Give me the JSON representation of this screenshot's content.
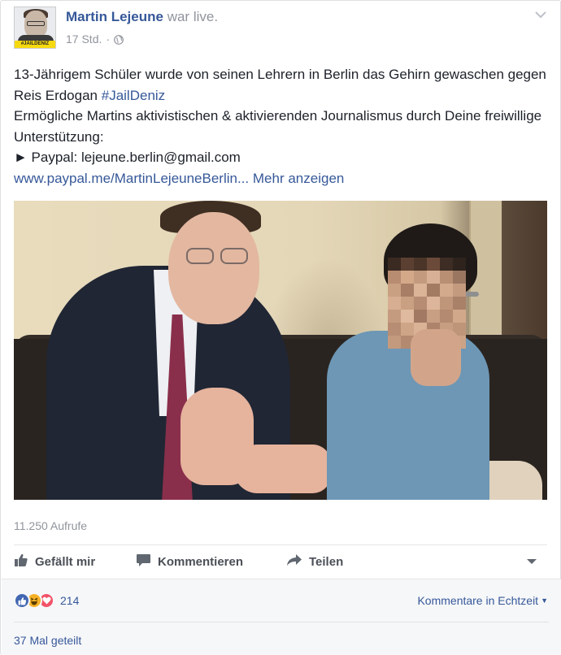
{
  "post": {
    "author": "Martin Lejeune",
    "action": "war live.",
    "time": "17 Std.",
    "dot": "·",
    "avatar_badge": "#JAILDENIZ",
    "audience_icon": "globe-icon",
    "text": {
      "line1": "13-Jährigem Schüler wurde von seinen Lehrern in Berlin das Gehirn gewaschen gegen Reis Erdogan",
      "hashtag": "#JailDeniz",
      "line2": "Ermögliche Martins aktivistischen & aktivierenden Journalismus durch Deine freiwillige Unterstützung:",
      "line3": "► Paypal: lejeune.berlin@gmail.com",
      "link": "www.paypal.me/MartinLejeuneBerlin...",
      "more": "Mehr anzeigen"
    }
  },
  "video": {
    "icon": "video-thumbnail"
  },
  "stats": {
    "views": "11.250 Aufrufe"
  },
  "actions": {
    "like": "Gefällt mir",
    "comment": "Kommentieren",
    "share": "Teilen"
  },
  "footer": {
    "reactions": [
      "like",
      "haha",
      "love"
    ],
    "reaction_count": "214",
    "realtime": "Kommentare in Echtzeit",
    "shares": "37 Mal geteilt"
  },
  "colors": {
    "link": "#365899",
    "muted": "#90949c",
    "like_blue": "#4267b2",
    "haha_yellow": "#f7b125",
    "love_red": "#f25268"
  }
}
